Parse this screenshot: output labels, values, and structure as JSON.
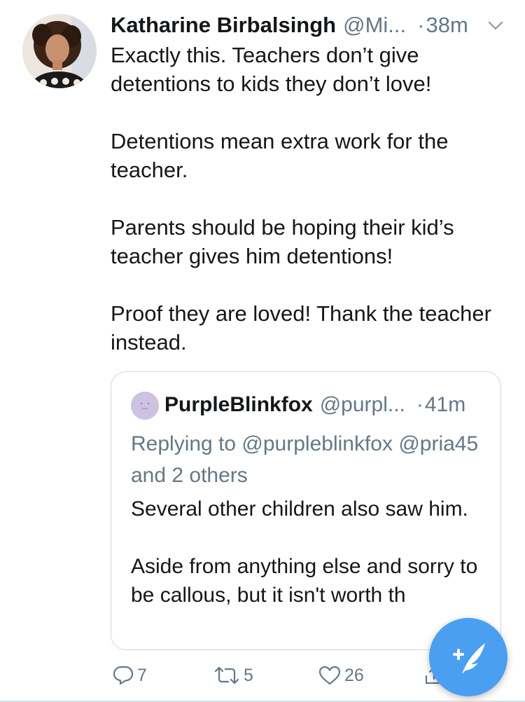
{
  "tweet": {
    "author_name": "Katharine Birbalsingh",
    "author_handle": "@Mi...",
    "separator": "·",
    "time": "38m",
    "paragraphs": [
      "Exactly this. Teachers don’t give detentions to kids they don’t love!",
      "Detentions mean extra work for the teacher.",
      "Parents should be hoping their kid’s teacher gives him detentions!",
      "Proof they are loved! Thank the teacher instead."
    ]
  },
  "quote": {
    "author_name": "PurpleBlinkfox",
    "author_handle": "@purpl...",
    "separator": "·",
    "time": "41m",
    "replying_to": "Replying to @purpleblinkfox @pria45 and 2 others",
    "paragraphs": [
      "Several other children also saw him.",
      "Aside from anything else and sorry to be callous, but it isn't worth th"
    ]
  },
  "actions": {
    "reply_count": "7",
    "retweet_count": "5",
    "like_count": "26"
  },
  "icons": {
    "caret": "chevron-down-icon",
    "reply": "reply-icon",
    "retweet": "retweet-icon",
    "like": "heart-icon",
    "share": "share-icon",
    "compose": "compose-tweet-icon"
  },
  "colors": {
    "text": "#14171a",
    "secondary": "#657786",
    "border": "#ccd6dd",
    "accent": "#4a9ff0"
  }
}
